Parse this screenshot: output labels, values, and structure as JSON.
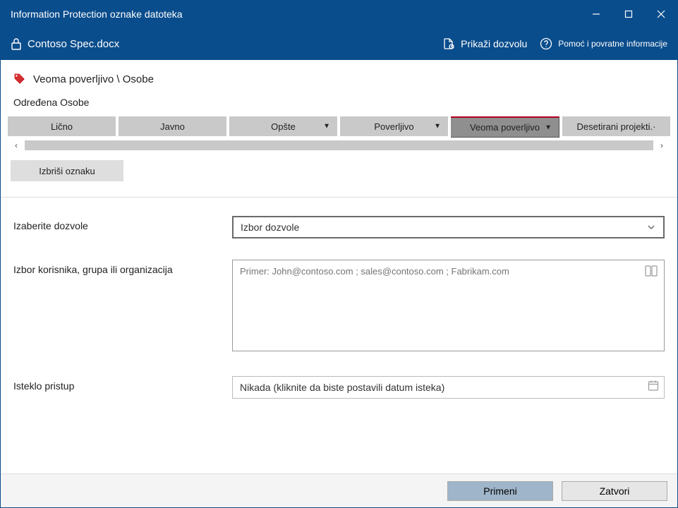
{
  "window": {
    "title": "Information Protection oznake datoteka"
  },
  "ribbon": {
    "document_name": "Contoso Spec.docx",
    "show_permission": "Prikaži dozvolu",
    "help": "Pomoć i povratne informacije"
  },
  "breadcrumb": "Veoma poverljivo \\ Osobe",
  "section_title": "Određena Osobe",
  "tabs": {
    "items": [
      {
        "label": "Lično",
        "has_dropdown": false,
        "selected": false
      },
      {
        "label": "Javno",
        "has_dropdown": false,
        "selected": false
      },
      {
        "label": "Opšte",
        "has_dropdown": true,
        "selected": false
      },
      {
        "label": "Poverljivo",
        "has_dropdown": true,
        "selected": false
      },
      {
        "label": "Veoma poverljivo",
        "has_dropdown": true,
        "selected": true
      },
      {
        "label": "Desetirani projekti.·",
        "has_dropdown": false,
        "selected": false
      }
    ]
  },
  "delete_label": "Izbriši oznaku",
  "form": {
    "permissions_label": "Izaberite dozvole",
    "permissions_value": "Izbor dozvole",
    "users_label": "Izbor korisnika, grupa ili organizacija",
    "users_placeholder": "Primer: John@contoso.com ; sales@contoso.com ; Fabrikam.com",
    "expire_label": "Isteklo pristup",
    "expire_value": "Nikada (kliknite da biste postavili datum isteka)"
  },
  "footer": {
    "apply": "Primeni",
    "close": "Zatvori"
  }
}
